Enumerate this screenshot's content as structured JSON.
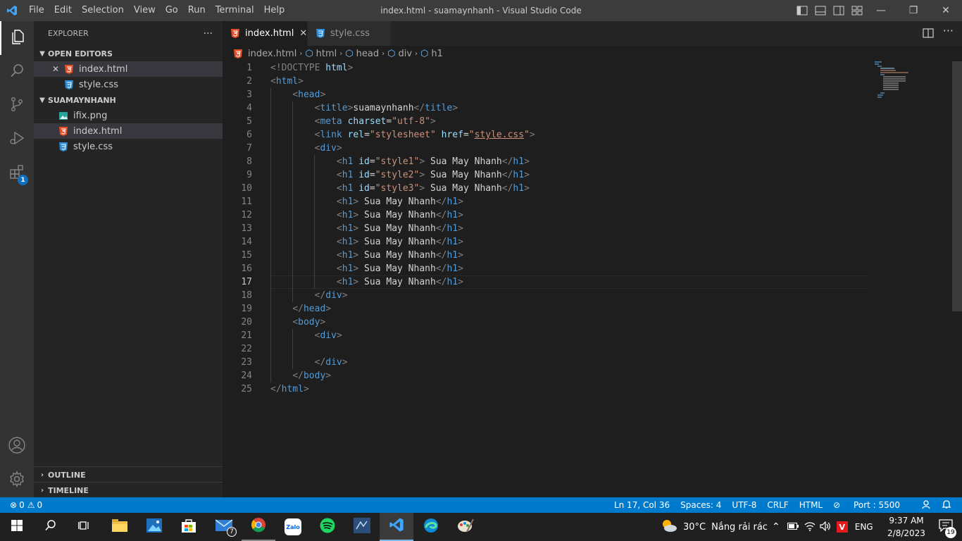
{
  "window": {
    "title": "index.html - suamaynhanh - Visual Studio Code",
    "menu": [
      "File",
      "Edit",
      "Selection",
      "View",
      "Go",
      "Run",
      "Terminal",
      "Help"
    ],
    "controls": {
      "minimize": "—",
      "restore": "❐",
      "close": "✕"
    }
  },
  "activity": {
    "items": [
      {
        "icon": "files-icon"
      },
      {
        "icon": "search-icon"
      },
      {
        "icon": "source-control-icon"
      },
      {
        "icon": "run-debug-icon"
      },
      {
        "icon": "extensions-icon"
      }
    ],
    "extensions_badge": "1",
    "bottom": [
      {
        "icon": "account-icon"
      },
      {
        "icon": "gear-icon"
      }
    ]
  },
  "sidebar": {
    "title": "EXPLORER",
    "more": "···",
    "open_editors": {
      "label": "OPEN EDITORS",
      "items": [
        {
          "name": "index.html",
          "type": "html",
          "selected": true
        },
        {
          "name": "style.css",
          "type": "css"
        }
      ]
    },
    "folder": {
      "label": "SUAMAYNHANH",
      "items": [
        {
          "name": "ifix.png",
          "type": "png"
        },
        {
          "name": "index.html",
          "type": "html",
          "selected": true
        },
        {
          "name": "style.css",
          "type": "css"
        }
      ]
    },
    "outline": "OUTLINE",
    "timeline": "TIMELINE"
  },
  "tabs": [
    {
      "label": "index.html",
      "type": "html",
      "active": true,
      "close": "✕"
    },
    {
      "label": "style.css",
      "type": "css",
      "active": false
    }
  ],
  "breadcrumb": [
    "index.html",
    "html",
    "head",
    "div",
    "h1"
  ],
  "editor": {
    "current_line": 17,
    "lines": [
      "<!DOCTYPE html>",
      "<html>",
      "    <head>",
      "        <title>suamaynhanh</title>",
      "        <meta charset=\"utf-8\">",
      "        <link rel=\"stylesheet\" href=\"style.css\">",
      "        <div>",
      "            <h1 id=\"style1\"> Sua May Nhanh</h1>",
      "            <h1 id=\"style2\"> Sua May Nhanh</h1>",
      "            <h1 id=\"style3\"> Sua May Nhanh</h1>",
      "            <h1> Sua May Nhanh</h1>",
      "            <h1> Sua May Nhanh</h1>",
      "            <h1> Sua May Nhanh</h1>",
      "            <h1> Sua May Nhanh</h1>",
      "            <h1> Sua May Nhanh</h1>",
      "            <h1> Sua May Nhanh</h1>",
      "            <h1> Sua May Nhanh</h1>",
      "        </div>",
      "    </head>",
      "    <body>",
      "        <div>",
      "",
      "        </div>",
      "    </body>",
      "</html>"
    ]
  },
  "status": {
    "errors": "0",
    "warnings": "0",
    "position": "Ln 17, Col 36",
    "spaces": "Spaces: 4",
    "encoding": "UTF-8",
    "eol": "CRLF",
    "language": "HTML",
    "port": "Port : 5500"
  },
  "taskbar": {
    "apps": [
      {
        "icon": "file-explorer-icon"
      },
      {
        "icon": "photos-icon"
      },
      {
        "icon": "store-icon"
      },
      {
        "icon": "mail-icon",
        "badge": "7"
      },
      {
        "icon": "chrome-icon"
      },
      {
        "icon": "zalo-icon",
        "label": "Zalo"
      },
      {
        "icon": "spotify-icon"
      },
      {
        "icon": "sql-icon"
      },
      {
        "icon": "vscode-icon"
      },
      {
        "icon": "edge-icon"
      },
      {
        "icon": "paint-icon"
      }
    ],
    "weather_temp": "30°C",
    "weather_text": "Nắng rải rác",
    "lang": "ENG",
    "time": "9:37 AM",
    "date": "2/8/2023",
    "notifications": "19",
    "colors": {
      "accent": "#007acc",
      "taskbar": "#202020"
    }
  }
}
